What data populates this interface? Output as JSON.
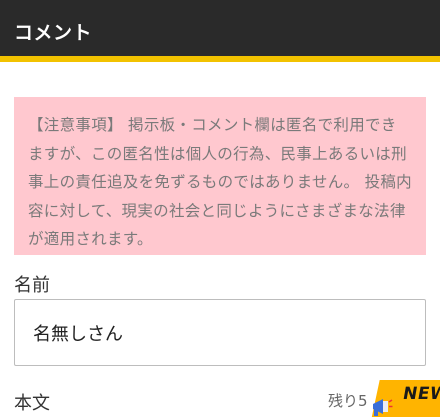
{
  "header": {
    "title": "コメント"
  },
  "notice": {
    "text": "【注意事項】 掲示板・コメント欄は匿名で利用できますが、この匿名性は個人の行為、民事上あるいは刑事上の責任追及を免ずるものではありません。 投稿内容に対して、現実の社会と同じようにさまざまな法律が適用されます。"
  },
  "form": {
    "name_label": "名前",
    "name_value": "名無しさん",
    "body_label": "本文",
    "remaining_text": "残り5"
  },
  "badge": {
    "text": "NEW",
    "color": "#ffb400"
  },
  "colors": {
    "header_bg": "#2a2a2a",
    "header_accent": "#f2c200",
    "notice_bg": "#ffc8cf"
  }
}
